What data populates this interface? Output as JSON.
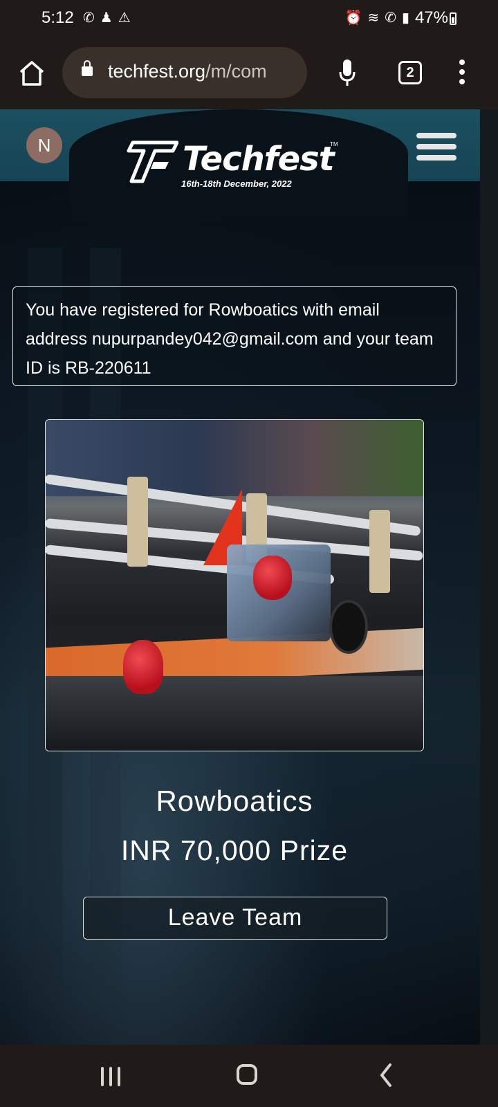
{
  "status_bar": {
    "time": "5:12",
    "left_icons": [
      "whatsapp-icon",
      "notification-icon",
      "warning-icon"
    ],
    "right_icons": [
      "alarm-icon",
      "wifi-icon",
      "wifi-calling-icon",
      "signal-icon"
    ],
    "battery": "47%"
  },
  "browser": {
    "url_host": "techfest.org",
    "url_path": "/m/com",
    "tab_count": "2"
  },
  "header": {
    "avatar_initial": "N",
    "logo_text": "Techfest",
    "logo_tm": "TM",
    "logo_date": "16th-18th December, 2022"
  },
  "notice": {
    "text": "You have registered for Rowboatics with email address nupurpandey042@gmail.com and your team ID is RB-220611"
  },
  "event": {
    "title": "Rowboatics",
    "prize": "INR 70,000 Prize",
    "leave_label": "Leave Team"
  },
  "colors": {
    "system_bar": "#201b18",
    "header_teal": "#1b5060",
    "page_dark": "#0b131b",
    "avatar": "#8d6d63"
  }
}
